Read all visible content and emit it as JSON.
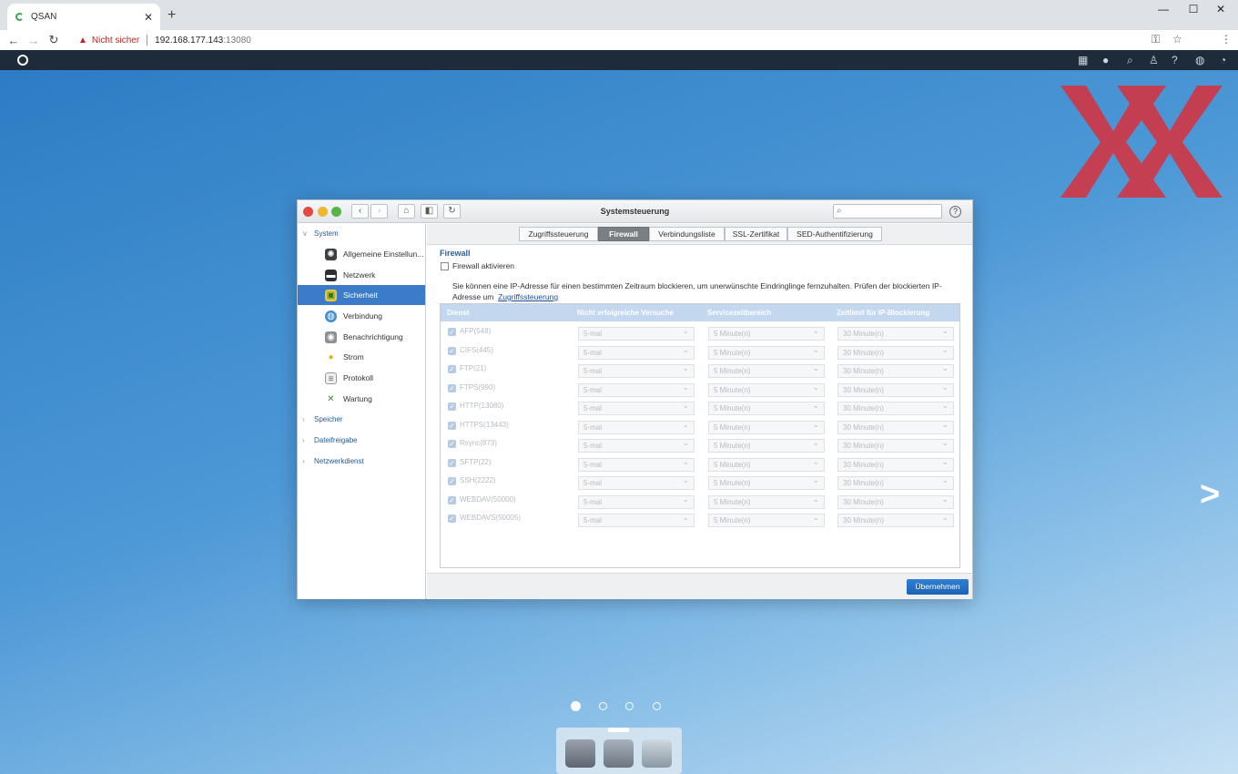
{
  "browser": {
    "tab_title": "QSAN",
    "security_label": "Nicht sicher",
    "url_host": "192.168.177.143",
    "url_port": ":13080"
  },
  "window": {
    "title": "Systemsteuerung",
    "search_placeholder": "",
    "help": "?"
  },
  "sidebar": {
    "groups": [
      {
        "label": "System"
      },
      {
        "label": "Speicher"
      },
      {
        "label": "Dateifreigabe"
      },
      {
        "label": "Netzwerkdienst"
      }
    ],
    "items": [
      {
        "label": "Allgemeine Einstellun...",
        "icon": "gear-icon"
      },
      {
        "label": "Netzwerk",
        "icon": "network-icon"
      },
      {
        "label": "Sicherheit",
        "icon": "lock-icon",
        "active": true
      },
      {
        "label": "Verbindung",
        "icon": "globe-icon"
      },
      {
        "label": "Benachrichtigung",
        "icon": "bell-icon"
      },
      {
        "label": "Strom",
        "icon": "bulb-icon"
      },
      {
        "label": "Protokoll",
        "icon": "log-icon"
      },
      {
        "label": "Wartung",
        "icon": "tools-icon"
      }
    ]
  },
  "tabs": [
    {
      "label": "Zugriffssteuerung"
    },
    {
      "label": "Firewall",
      "active": true
    },
    {
      "label": "Verbindungsliste"
    },
    {
      "label": "SSL-Zertifikat"
    },
    {
      "label": "SED-Authentifizierung"
    }
  ],
  "firewall": {
    "heading": "Firewall",
    "enable_label": "Firewall aktivieren",
    "enabled": false,
    "description": "Sie können eine IP-Adresse für einen bestimmten Zeitraum blockieren, um unerwünschte Eindringlinge fernzuhalten. Prüfen der blockierten IP-Adresse um",
    "description_link": "Zugriffssteuerung",
    "columns": [
      "Dienst",
      "Nicht erfolgreiche Versuche",
      "Servicezeitbereich",
      "Zeitlimit für IP-Blockierung"
    ],
    "rows": [
      {
        "service": "AFP(548)",
        "attempts": "5-mal",
        "range": "5 Minute(n)",
        "block": "30 Minute(n)"
      },
      {
        "service": "CIFS(445)",
        "attempts": "5-mal",
        "range": "5 Minute(n)",
        "block": "30 Minute(n)"
      },
      {
        "service": "FTP(21)",
        "attempts": "5-mal",
        "range": "5 Minute(n)",
        "block": "30 Minute(n)"
      },
      {
        "service": "FTPS(990)",
        "attempts": "5-mal",
        "range": "5 Minute(n)",
        "block": "30 Minute(n)"
      },
      {
        "service": "HTTP(13080)",
        "attempts": "5-mal",
        "range": "5 Minute(n)",
        "block": "30 Minute(n)"
      },
      {
        "service": "HTTPS(13443)",
        "attempts": "5-mal",
        "range": "5 Minute(n)",
        "block": "30 Minute(n)"
      },
      {
        "service": "Rsync(873)",
        "attempts": "5-mal",
        "range": "5 Minute(n)",
        "block": "30 Minute(n)"
      },
      {
        "service": "SFTP(22)",
        "attempts": "5-mal",
        "range": "5 Minute(n)",
        "block": "30 Minute(n)"
      },
      {
        "service": "SSH(2222)",
        "attempts": "5-mal",
        "range": "5 Minute(n)",
        "block": "30 Minute(n)"
      },
      {
        "service": "WEBDAV(50000)",
        "attempts": "5-mal",
        "range": "5 Minute(n)",
        "block": "30 Minute(n)"
      },
      {
        "service": "WEBDAVS(50005)",
        "attempts": "5-mal",
        "range": "5 Minute(n)",
        "block": "30 Minute(n)"
      }
    ],
    "apply_label": "Übernehmen"
  },
  "colors": {
    "accent": "#3c7bc8",
    "apply": "#1d62b5",
    "table_header": "#c3d8ee"
  }
}
